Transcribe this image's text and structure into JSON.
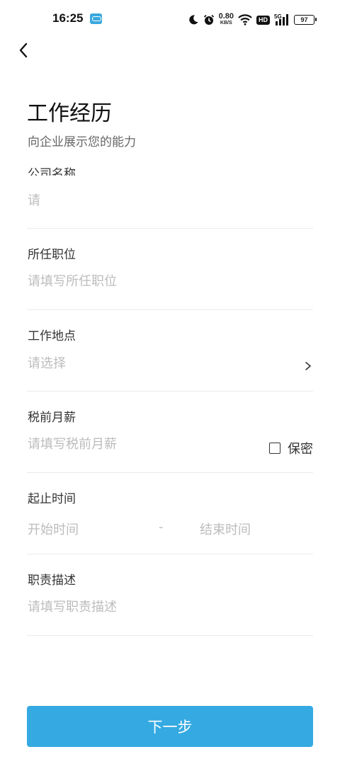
{
  "status_bar": {
    "time": "16:25",
    "speed_value": "0.80",
    "speed_unit": "KB/S",
    "hd": "HD",
    "network": "5G",
    "battery": "97"
  },
  "page": {
    "title": "工作经历",
    "subtitle": "向企业展示您的能力"
  },
  "fields": {
    "company": {
      "label": "公司名称",
      "placeholder": "请"
    },
    "position": {
      "label": "所任职位",
      "placeholder": "请填写所任职位"
    },
    "location": {
      "label": "工作地点",
      "placeholder": "请选择"
    },
    "salary": {
      "label": "税前月薪",
      "placeholder": "请填写税前月薪",
      "secret_label": "保密"
    },
    "period": {
      "label": "起止时间",
      "start_placeholder": "开始时间",
      "separator": "-",
      "end_placeholder": "结束时间"
    },
    "duty": {
      "label": "职责描述",
      "placeholder": "请填写职责描述"
    }
  },
  "next_button": {
    "label": "下一步"
  },
  "colors": {
    "accent": "#35aae2",
    "placeholder": "#bcbcbc",
    "divider": "#ebebeb"
  }
}
